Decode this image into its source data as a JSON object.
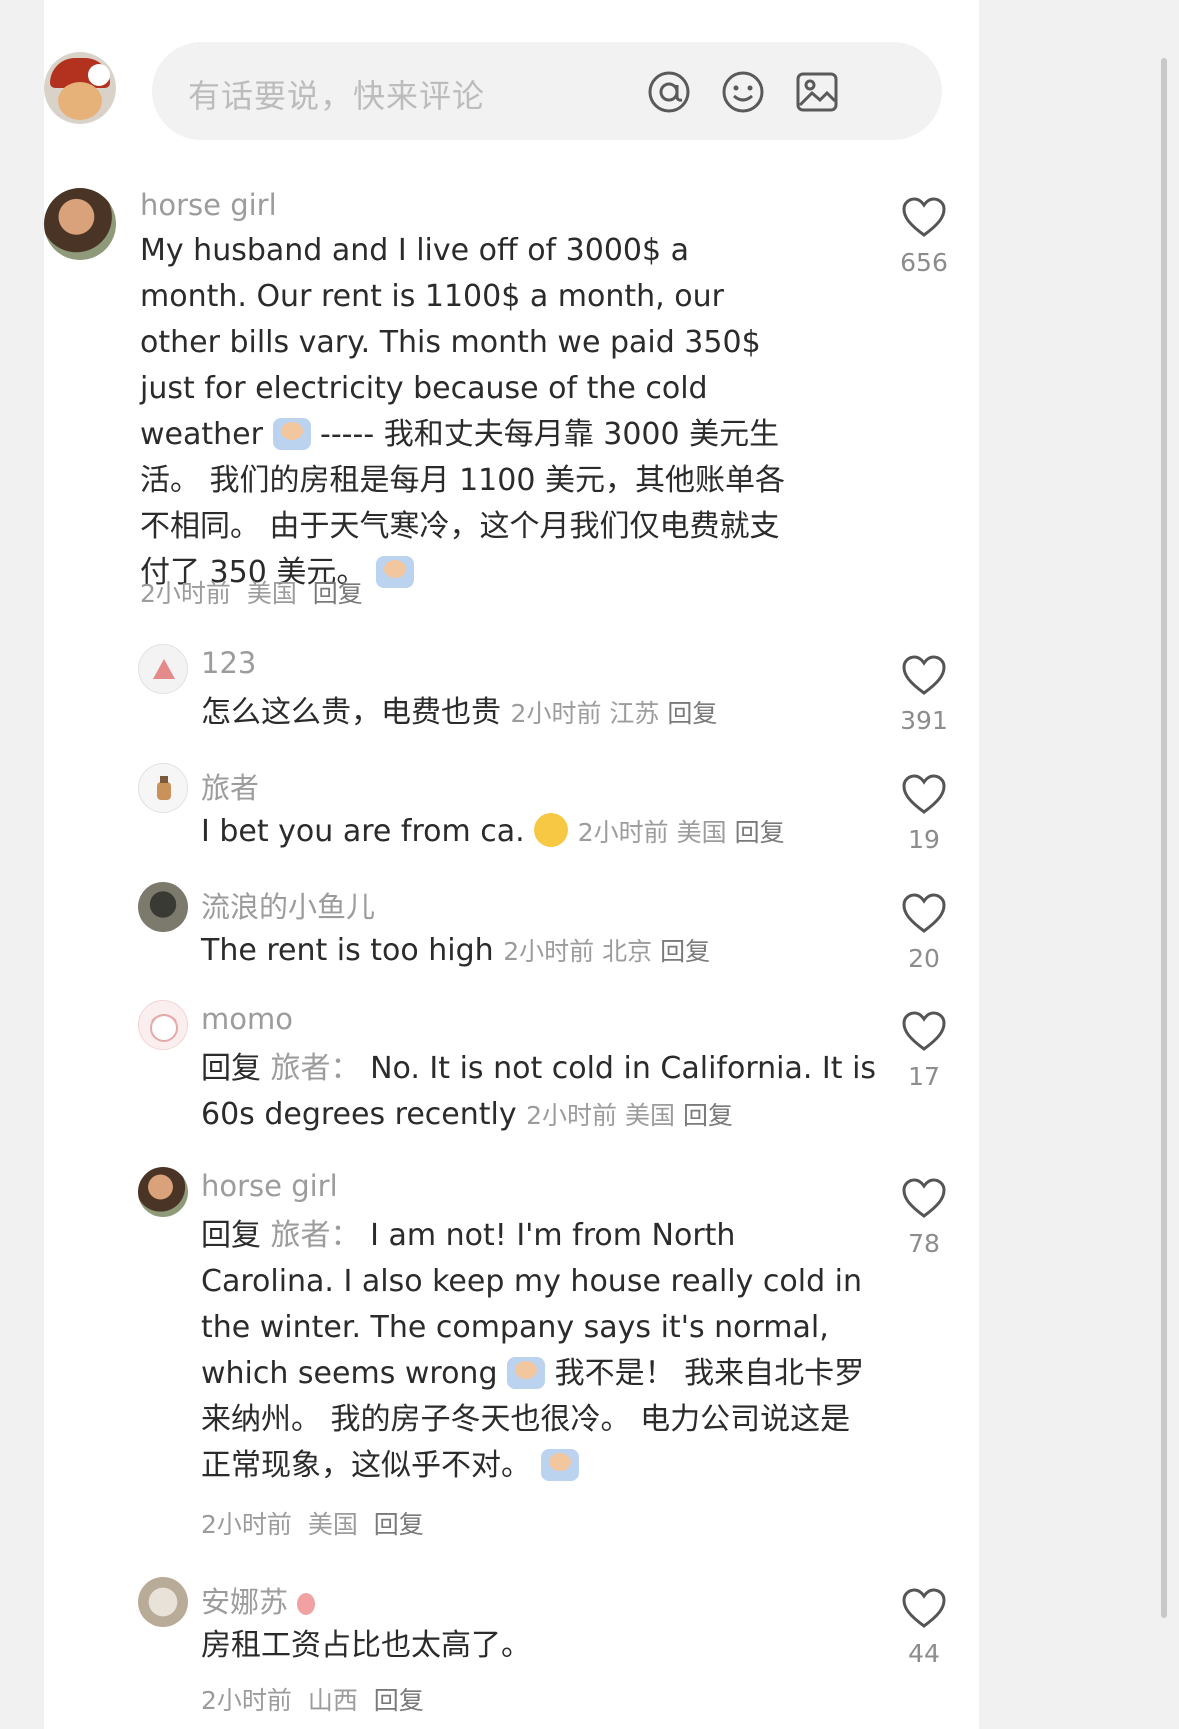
{
  "input": {
    "placeholder": "有话要说，快来评论"
  },
  "icons": {
    "mention": "at-icon",
    "emoji": "emoji-icon",
    "image": "image-icon",
    "like": "heart-icon"
  },
  "comments": [
    {
      "user": "horse girl",
      "text_before_emoji": "My husband and I live off of 3000$ a month. Our rent is 1100$ a month, our other bills vary. This month we paid 350$ just for electricity because of the cold weather",
      "text_after_emoji": " ----- 我和丈夫每月靠 3000 美元生活。 我们的房租是每月 1100 美元，其他账单各不相同。 由于天气寒冷，这个月我们仅电费就支付了 350 美元。",
      "time": "2小时前",
      "location": "美国",
      "reply": "回复",
      "likes": "656"
    }
  ],
  "replies": [
    {
      "user": "123",
      "text": "怎么这么贵，电费也贵",
      "time": "2小时前",
      "location": "江苏",
      "reply": "回复",
      "likes": "391"
    },
    {
      "user": "旅者",
      "text": "I bet you are from ca.",
      "time": "2小时前",
      "location": "美国",
      "reply": "回复",
      "likes": "19"
    },
    {
      "user": "流浪的小鱼儿",
      "text": "The rent is too high",
      "time": "2小时前",
      "location": "北京",
      "reply": "回复",
      "likes": "20"
    },
    {
      "user": "momo",
      "reply_label": "回复",
      "reply_to": "旅者：",
      "text": "No. It is not cold in California. It is 60s degrees recently",
      "time": "2小时前",
      "location": "美国",
      "reply": "回复",
      "likes": "17"
    },
    {
      "user": "horse girl",
      "reply_label": "回复",
      "reply_to": "旅者：",
      "text_before_emoji": "I am not! I'm from North Carolina. I also keep my house really cold in the winter. The company says it's normal, which seems wrong",
      "text_after_emoji": " 我不是！ 我来自北卡罗来纳州。 我的房子冬天也很冷。 电力公司说这是正常现象，这似乎不对。",
      "time": "2小时前",
      "location": "美国",
      "reply": "回复",
      "likes": "78"
    },
    {
      "user": "安娜苏",
      "text": "房租工资占比也太高了。",
      "time": "2小时前",
      "location": "山西",
      "reply": "回复",
      "likes": "44"
    }
  ]
}
